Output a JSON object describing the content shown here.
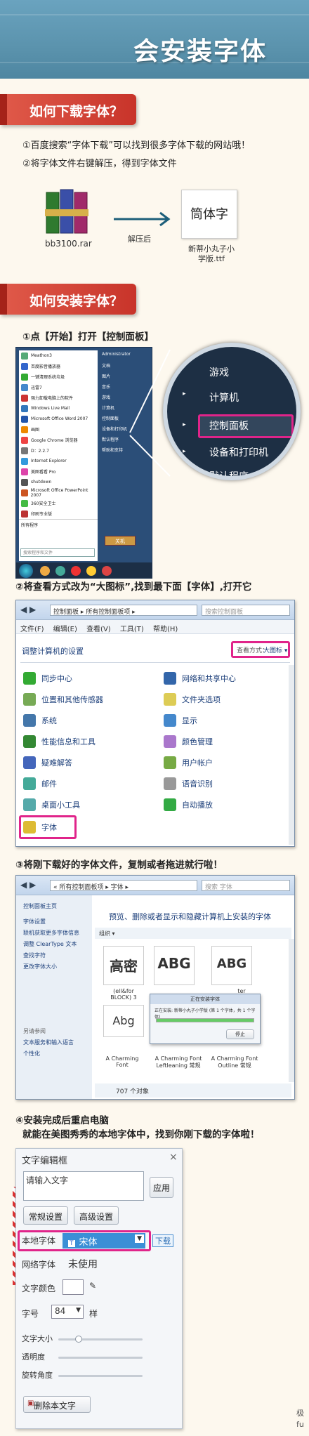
{
  "title": "会安装字体",
  "sections": {
    "download": {
      "heading": "如何下载字体？",
      "line1": "①百度搜索“字体下载”可以找到很多字体下载的网站哦！",
      "line2": "②将字体文件右键解压，得到字体文件",
      "archive_label": "bb3100.rar",
      "arrow_label": "解压后",
      "font_preview": "筒体字",
      "font_file_label_1": "新蒂小丸子小",
      "font_file_label_2": "学版.ttf"
    },
    "install": {
      "heading": "如何安装字体？",
      "step1": "①点【开始】打开【控制面板】",
      "step2": "②将查看方式改为“大图标”,找到最下面【字体】,打开它",
      "step3": "③将刚下载好的字体文件，复制或者拖进就行啦！",
      "step4_line1": "④安装完成后重启电脑",
      "step4_line2": "就能在美图秀秀的本地字体中，找到你刚下载的字体啦！"
    }
  },
  "start_menu": {
    "left_items": [
      "Meathon3",
      "百度影音播放器",
      "一键清理系统垃圾",
      "迅雷7",
      "强力卸载电脑上的软件",
      "Windows Live Mail",
      "Microsoft Office Word 2007",
      "画图",
      "Google Chrome 浏览器",
      "D：2.2.7",
      "Internet Explorer",
      "美图看看 Pro",
      "shutdown",
      "Microsoft Office PowerPoint 2007",
      "360安全卫士",
      "印刷专业版"
    ],
    "all_programs": "所有程序",
    "search_placeholder": "搜索程序和文件",
    "right_items": [
      "Administrator",
      "文档",
      "图片",
      "音乐",
      "游戏",
      "计算机",
      "控制面板",
      "设备和打印机",
      "默认程序",
      "帮助和支持"
    ],
    "shutdown": "关机"
  },
  "magnifier_items": [
    "游戏",
    "计算机",
    "控制面板",
    "设备和打印机",
    "默认程序"
  ],
  "control_panel": {
    "breadcrumb": "控制面板 ▸ 所有控制面板项 ▸",
    "search_placeholder": "搜索控制面板",
    "menu": [
      "文件(F)",
      "编辑(E)",
      "查看(V)",
      "工具(T)",
      "帮助(H)"
    ],
    "heading": "调整计算机的设置",
    "view_label": "查看方式：",
    "view_value": "大图标 ▾",
    "left_items": [
      "同步中心",
      "位置和其他传感器",
      "系统",
      "性能信息和工具",
      "疑难解答",
      "邮件",
      "桌面小工具",
      "字体"
    ],
    "right_items": [
      "网络和共享中心",
      "文件夹选项",
      "显示",
      "颜色管理",
      "用户帐户",
      "语音识别",
      "自动播放"
    ]
  },
  "fonts_window": {
    "breadcrumb": "« 所有控制面板项 ▸ 字体 ▸",
    "search_placeholder": "搜索 字体",
    "left_links": [
      "控制面板主页",
      "字体设置",
      "联机获取更多字体信息",
      "调整 ClearType 文本",
      "查找字符",
      "更改字体大小"
    ],
    "see_also": "另请参阅",
    "see_also_links": [
      "文本服务和输入语言",
      "个性化"
    ],
    "header_text": "预览、删除或者显示和隐藏计算机上安装的字体",
    "organize": "组织 ▾",
    "font_tiles": [
      {
        "glyph": "高密",
        "name": "(ell&for BLOCK) 3"
      },
      {
        "glyph": "ABG",
        "name": ""
      },
      {
        "glyph": "ABG",
        "name": "ter"
      },
      {
        "glyph": "Abg",
        "name": "A Charming Font"
      },
      {
        "glyph": "",
        "name": "A Charming Font Leftleaning 常规"
      },
      {
        "glyph": "",
        "name": "A Charming Font Outline 常规"
      }
    ],
    "dialog_title": "正在安装字体",
    "dialog_text": "正在安装: 新蒂小丸子小学版 (第 1 个字体，共 1 个字体)",
    "dialog_stop": "停止",
    "status": "707 个对象"
  },
  "editor": {
    "title": "文字编辑框",
    "close": "×",
    "text_value": "请输入文字",
    "apply_button": "应用",
    "tab_general": "常规设置",
    "tab_advanced": "高级设置",
    "local_font_label": "本地字体",
    "local_font_value": "宋体",
    "download_button": "下载",
    "web_font_label": "网络字体",
    "web_font_value": "未使用",
    "color_label": "文字颜色",
    "size_label": "字号",
    "size_value": "84",
    "style_label": "样",
    "text_size_label": "文字大小",
    "opacity_label": "透明度",
    "rotation_label": "旋转角度",
    "delete_button": "删除本文字"
  },
  "corner_text_1": "极",
  "corner_text_2": "fu",
  "colors": {
    "banner": "#5b93ad",
    "section": "#c8342a",
    "highlight": "#e0248a"
  }
}
